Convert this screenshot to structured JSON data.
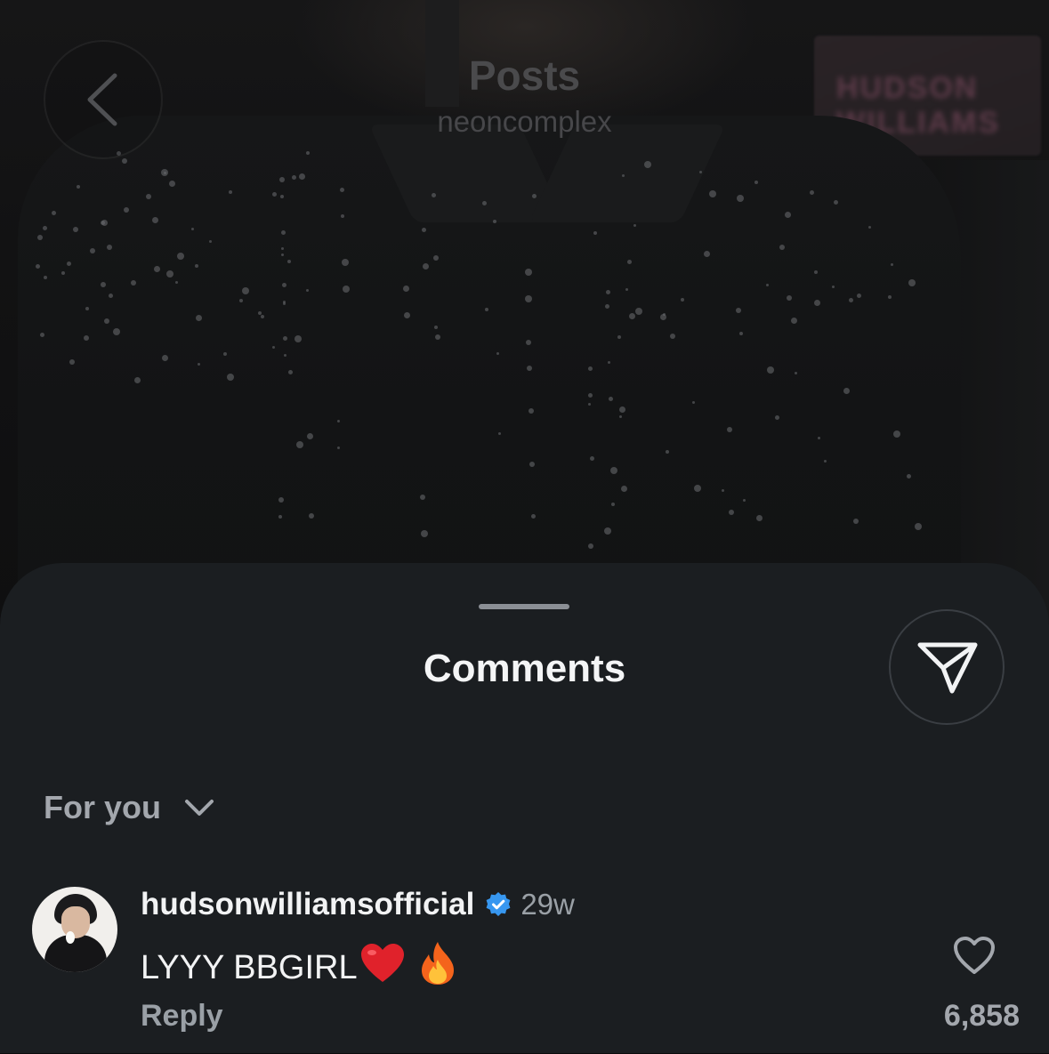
{
  "header": {
    "title": "Posts",
    "subtitle": "neoncomplex"
  },
  "background": {
    "sign_text": "HUDSON WILLIAMS"
  },
  "sheet": {
    "title": "Comments",
    "sort_label": "For you"
  },
  "comments": [
    {
      "username": "hudsonwilliamsofficial",
      "verified": true,
      "time": "29w",
      "text": "LYYY BBGIRL",
      "emoji_1": "❤️",
      "emoji_2": "🔥",
      "reply_label": "Reply",
      "like_count": "6,858"
    }
  ],
  "colors": {
    "sheet_bg": "#1b1e21",
    "verified_blue": "#3797f0",
    "heart_red": "#e0222b"
  }
}
